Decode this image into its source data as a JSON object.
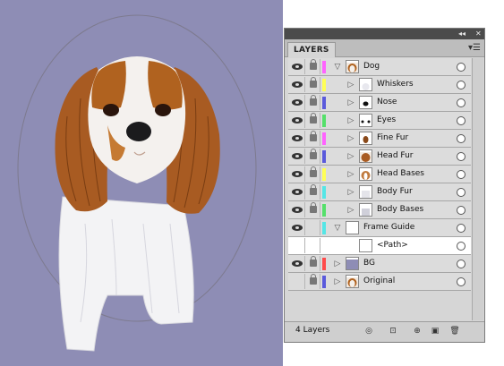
{
  "panel": {
    "tab_label": "LAYERS",
    "collapse_icon": "double-chevron-left-icon",
    "close_icon": "close-icon",
    "menu_icon": "panel-menu-icon",
    "layer_count": "4 Layers"
  },
  "layers": [
    {
      "name": "Dog",
      "level": 0,
      "expanded": true,
      "visible": true,
      "locked": true,
      "color": "#ff63ff",
      "thumb": "dog"
    },
    {
      "name": "Whiskers",
      "level": 1,
      "expanded": false,
      "visible": true,
      "locked": true,
      "color": "#ffff55",
      "thumb": "whiskers"
    },
    {
      "name": "Nose",
      "level": 1,
      "expanded": false,
      "visible": true,
      "locked": true,
      "color": "#5a5adc",
      "thumb": "nose"
    },
    {
      "name": "Eyes",
      "level": 1,
      "expanded": false,
      "visible": true,
      "locked": true,
      "color": "#55e06a",
      "thumb": "eyes"
    },
    {
      "name": "Fine Fur",
      "level": 1,
      "expanded": false,
      "visible": true,
      "locked": true,
      "color": "#ff63ff",
      "thumb": "finefur"
    },
    {
      "name": "Head Fur",
      "level": 1,
      "expanded": false,
      "visible": true,
      "locked": true,
      "color": "#5a5adc",
      "thumb": "headfur"
    },
    {
      "name": "Head Bases",
      "level": 1,
      "expanded": false,
      "visible": true,
      "locked": true,
      "color": "#ffff55",
      "thumb": "headbases"
    },
    {
      "name": "Body Fur",
      "level": 1,
      "expanded": false,
      "visible": true,
      "locked": true,
      "color": "#55e6e6",
      "thumb": "bodyfur"
    },
    {
      "name": "Body Bases",
      "level": 1,
      "expanded": false,
      "visible": true,
      "locked": true,
      "color": "#55e06a",
      "thumb": "bodybases"
    },
    {
      "name": "Frame Guide",
      "level": 0,
      "expanded": true,
      "visible": true,
      "locked": false,
      "color": "#55e6e6",
      "thumb": "blank"
    },
    {
      "name": "<Path>",
      "level": 1,
      "expanded": null,
      "visible": false,
      "locked": false,
      "color": "",
      "thumb": "blank",
      "selected": true
    },
    {
      "name": "BG",
      "level": 0,
      "expanded": false,
      "visible": true,
      "locked": true,
      "color": "#ff4b4b",
      "thumb": "bg"
    },
    {
      "name": "Original",
      "level": 0,
      "expanded": false,
      "visible": false,
      "locked": true,
      "color": "#5a5adc",
      "thumb": "dog"
    }
  ],
  "footer_icons": [
    "locate-object-icon",
    "make-clipping-mask-icon",
    "new-sublayer-icon",
    "new-layer-icon",
    "trash-icon"
  ]
}
